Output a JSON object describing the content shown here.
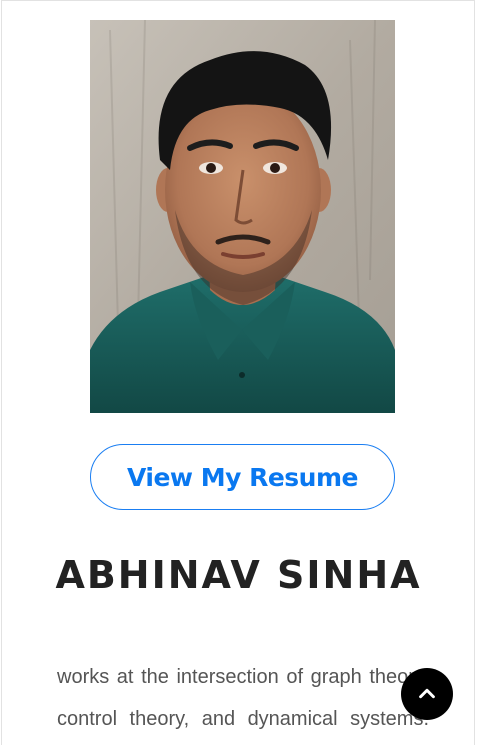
{
  "profile": {
    "photo_alt": "Abhinav Sinha",
    "resume_button_label": "View My Resume",
    "name": "ABHINAV SINHA",
    "bio_lines": [
      "works at the intersection of graph theory,",
      "control theory, and dynamical systems."
    ]
  },
  "colors": {
    "accent": "#0a78f0",
    "heading": "#222222",
    "body_text": "#555555",
    "scroll_top_bg": "#000000"
  },
  "icons": {
    "scroll_top": "chevron-up-icon"
  }
}
